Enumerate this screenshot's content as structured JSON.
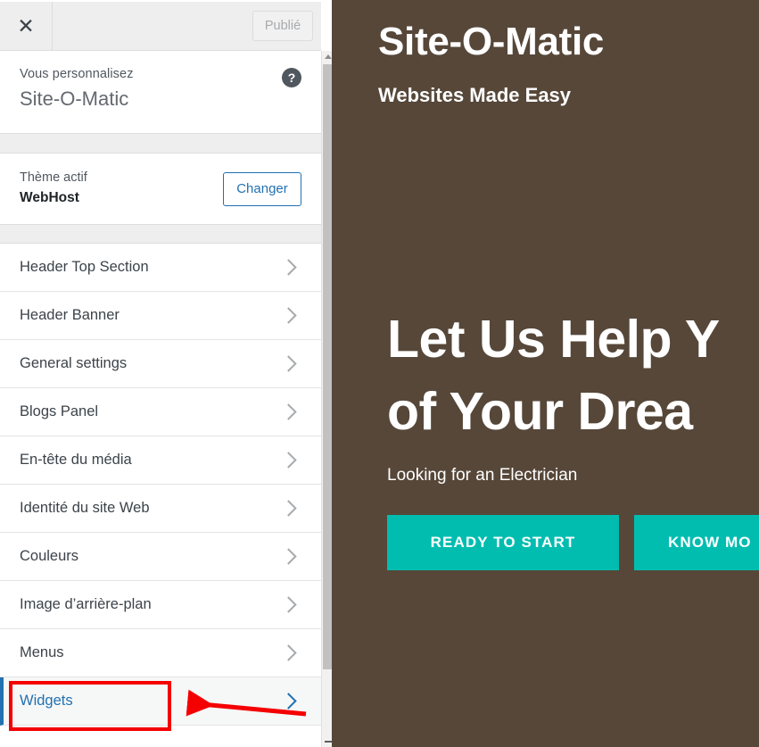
{
  "topbar": {
    "close_icon": "close-icon",
    "publish_label": "Publié"
  },
  "panel_header": {
    "eyebrow": "Vous personnalisez",
    "site_name": "Site-O-Matic",
    "help_icon": "help-icon",
    "help_glyph": "?"
  },
  "theme": {
    "label": "Thème actif",
    "name": "WebHost",
    "change_label": "Changer"
  },
  "menu": {
    "items": [
      {
        "label": "Header Top Section",
        "active": false
      },
      {
        "label": "Header Banner",
        "active": false
      },
      {
        "label": "General settings",
        "active": false
      },
      {
        "label": "Blogs Panel",
        "active": false
      },
      {
        "label": "En-tête du média",
        "active": false
      },
      {
        "label": "Identité du site Web",
        "active": false
      },
      {
        "label": "Couleurs",
        "active": false
      },
      {
        "label": "Image d’arrière-plan",
        "active": false
      },
      {
        "label": "Menus",
        "active": false
      },
      {
        "label": "Widgets",
        "active": true
      }
    ]
  },
  "preview": {
    "site_title": "Site-O-Matic",
    "tagline": "Websites Made Easy",
    "hero_line1": "Let Us Help Y",
    "hero_line2": "of Your Drea",
    "hero_sub": "Looking for an Electrician",
    "buttons": [
      {
        "label": "READY TO START"
      },
      {
        "label": "KNOW MO"
      }
    ],
    "background_color": "#564739",
    "button_color": "#00bdb0"
  },
  "annotations": {
    "highlight_color": "#f40000",
    "highlight_target": "Widgets",
    "arrow_direction": "left"
  },
  "colors": {
    "accent_blue": "#2271b1",
    "sidebar_bg": "#ffffff",
    "topbar_bg": "#eeeeee"
  }
}
